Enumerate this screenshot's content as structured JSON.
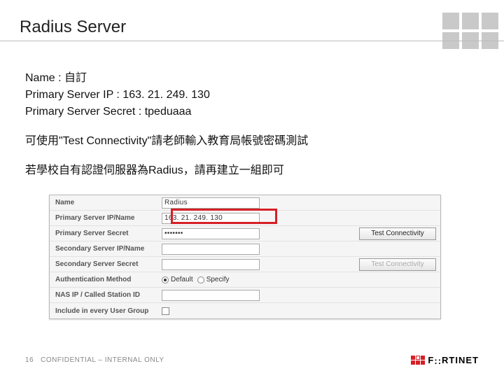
{
  "title": "Radius Server",
  "body": {
    "line1": "Name : 自訂",
    "line2": "Primary Server IP : 163. 21. 249. 130",
    "line3": "Primary Server Secret : tpeduaaa",
    "line4": "可使用\"Test Connectivity\"請老師輸入教育局帳號密碼測試",
    "line5": "若學校自有認證伺服器為Radius，請再建立一組即可"
  },
  "panel": {
    "labels": {
      "name": "Name",
      "primary_ip": "Primary Server IP/Name",
      "primary_secret": "Primary Server Secret",
      "secondary_ip": "Secondary Server IP/Name",
      "secondary_secret": "Secondary Server Secret",
      "auth_method": "Authentication Method",
      "nas_ip": "NAS IP / Called Station ID",
      "include": "Include in every User Group"
    },
    "values": {
      "name": "Radius",
      "primary_ip": "163. 21. 249. 130",
      "primary_secret": "•••••••",
      "secondary_ip": "",
      "secondary_secret": "",
      "nas_ip": ""
    },
    "buttons": {
      "test1": "Test Connectivity",
      "test2": "Test Connectivity"
    },
    "auth": {
      "default": "Default",
      "specify": "Specify"
    }
  },
  "footer": {
    "page": "16",
    "conf": "CONFIDENTIAL – INTERNAL ONLY",
    "brand": "F¡¡RTINET"
  }
}
